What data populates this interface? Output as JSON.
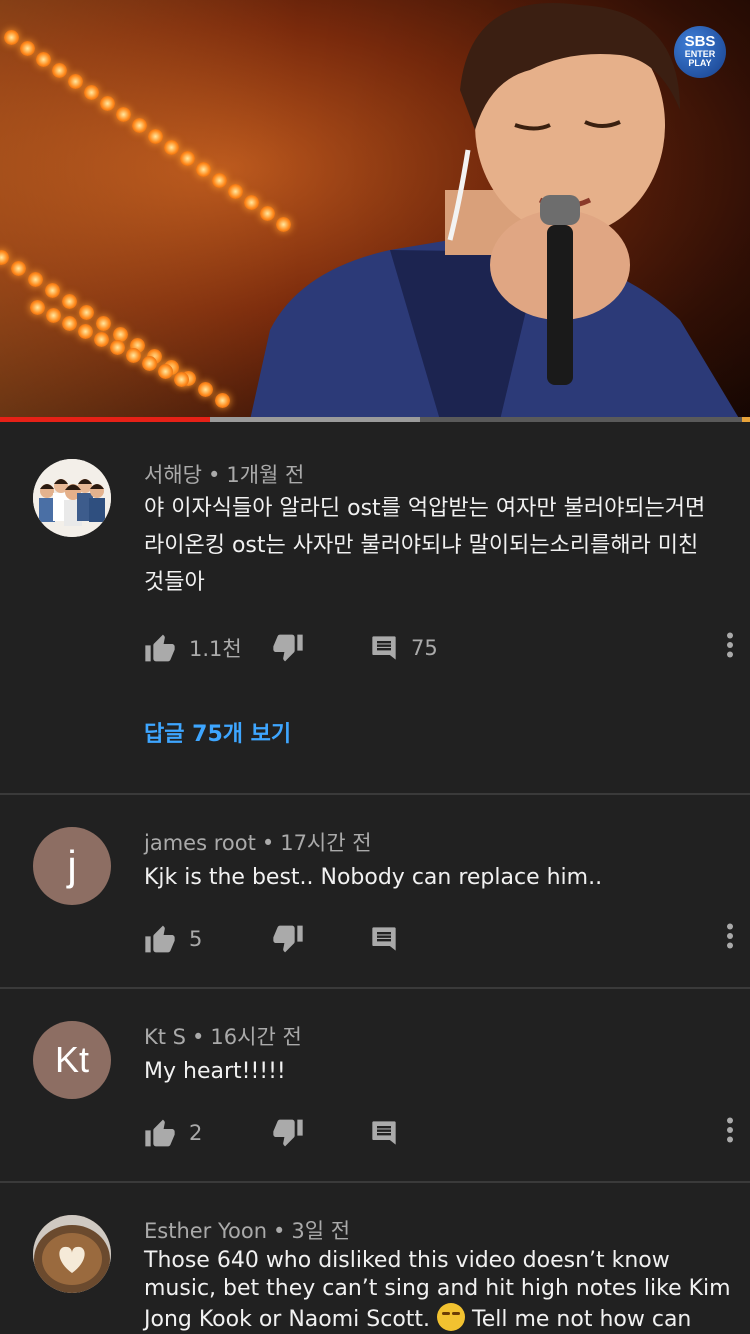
{
  "video": {
    "channel_logo": {
      "line1": "SBS",
      "line2": "ENTER",
      "line3": "PLAY"
    },
    "progress": {
      "played_fraction": 0.28,
      "buffered_fraction": 0.56
    }
  },
  "comments": [
    {
      "author": "서해당",
      "time": "1개월 전",
      "avatar": "group-photo",
      "text": "야 이자식들아 알라딘 ost를 억압받는 여자만 불러야되는거면 라이온킹 ost는 사자만 불러야되냐 말이되는소리를해라 미친 것들아",
      "likes": "1.1천",
      "reply_count": "75",
      "view_replies": "답글 75개 보기"
    },
    {
      "author": "james root",
      "time": "17시간 전",
      "avatar_letter": "j",
      "text": "Kjk is the best.. Nobody can replace him..",
      "likes": "5"
    },
    {
      "author": "Kt S",
      "time": "16시간 전",
      "avatar_letter": "Kt",
      "text": "My heart!!!!!",
      "likes": "2"
    },
    {
      "author": "Esther Yoon",
      "time": "3일 전",
      "avatar": "latte-art-photo",
      "text_before_emoji": "Those 640 who disliked this video doesn’t know music, bet they can’t sing and hit high notes like Kim Jong Kook or Naomi Scott. ",
      "text_after_emoji": " Tell me not how can"
    }
  ],
  "icons": {
    "like": "thumb-up-icon",
    "dislike": "thumb-down-icon",
    "reply": "comment-icon",
    "more": "more-vertical-icon"
  },
  "colors": {
    "background": "#212121",
    "link": "#3ea6ff",
    "progress_played": "#e62117"
  }
}
